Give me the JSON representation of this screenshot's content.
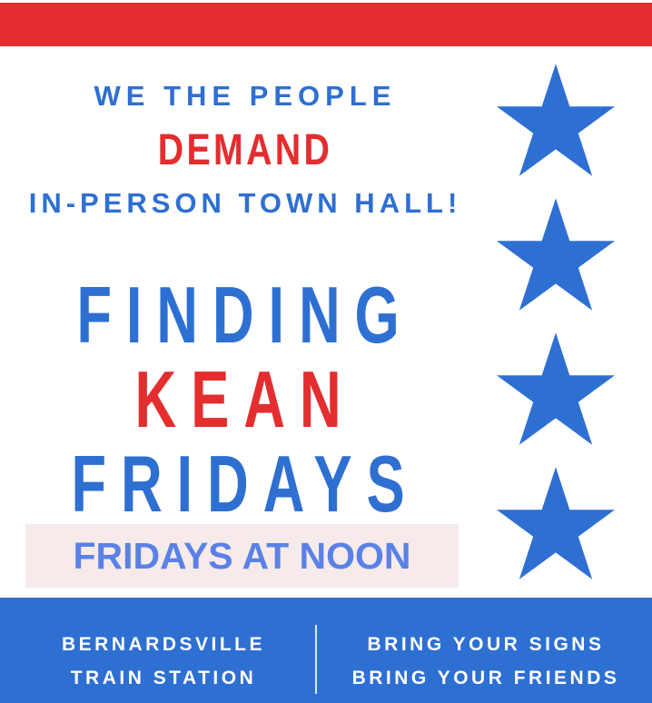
{
  "header": {
    "line1": "WE THE PEOPLE",
    "line2": "DEMAND",
    "line3": "IN-PERSON TOWN HALL!"
  },
  "title": {
    "word1": "FINDING",
    "word2": "KEAN",
    "word3": "FRIDAYS"
  },
  "schedule": "FRIDAYS AT NOON",
  "footer": {
    "location_line1": "BERNARDSVILLE",
    "location_line2": "TRAIN STATION",
    "call_line1": "BRING YOUR SIGNS",
    "call_line2": "BRING YOUR FRIENDS"
  },
  "colors": {
    "red": "#e32d2f",
    "blue": "#2e6fd2",
    "light_blue_text": "#5a82e6",
    "highlight_bg": "#f7eaea"
  },
  "icons": [
    "star-icon",
    "star-icon",
    "star-icon",
    "star-icon"
  ]
}
